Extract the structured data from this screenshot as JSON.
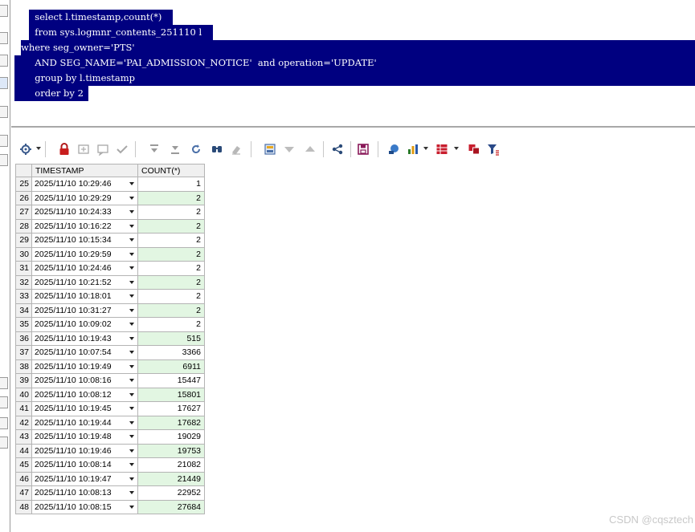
{
  "editor": {
    "sql_lines": [
      "  select l.timestamp,count(*)",
      "  from sys.logmnr_contents_251110 l",
      "where seg_owner='PTS'",
      "  AND SEG_NAME='PAI_ADMISSION_NOTICE'  and operation='UPDATE'",
      "  group by l.timestamp",
      "  order by 2"
    ],
    "selection_color": "#000080"
  },
  "toolbar": {
    "icons": [
      "settings-icon",
      "lock-icon",
      "add-record-icon",
      "comment-icon",
      "post-icon",
      "first-record-icon",
      "last-record-icon",
      "refresh-icon",
      "find-icon",
      "clear-icon",
      "query-by-example-icon",
      "sort-desc-icon",
      "sort-asc-icon",
      "link-icon",
      "save-icon",
      "export-icon",
      "chart-icon",
      "single-record-icon",
      "compare-icon",
      "filter-icon"
    ]
  },
  "grid": {
    "columns": [
      "TIMESTAMP",
      "COUNT(*)"
    ],
    "rows": [
      {
        "n": "25",
        "ts": "2025/11/10 10:29:46",
        "c": "1"
      },
      {
        "n": "26",
        "ts": "2025/11/10 10:29:29",
        "c": "2"
      },
      {
        "n": "27",
        "ts": "2025/11/10 10:24:33",
        "c": "2"
      },
      {
        "n": "28",
        "ts": "2025/11/10 10:16:22",
        "c": "2"
      },
      {
        "n": "29",
        "ts": "2025/11/10 10:15:34",
        "c": "2"
      },
      {
        "n": "30",
        "ts": "2025/11/10 10:29:59",
        "c": "2"
      },
      {
        "n": "31",
        "ts": "2025/11/10 10:24:46",
        "c": "2"
      },
      {
        "n": "32",
        "ts": "2025/11/10 10:21:52",
        "c": "2"
      },
      {
        "n": "33",
        "ts": "2025/11/10 10:18:01",
        "c": "2"
      },
      {
        "n": "34",
        "ts": "2025/11/10 10:31:27",
        "c": "2"
      },
      {
        "n": "35",
        "ts": "2025/11/10 10:09:02",
        "c": "2"
      },
      {
        "n": "36",
        "ts": "2025/11/10 10:19:43",
        "c": "515"
      },
      {
        "n": "37",
        "ts": "2025/11/10 10:07:54",
        "c": "3366"
      },
      {
        "n": "38",
        "ts": "2025/11/10 10:19:49",
        "c": "6911"
      },
      {
        "n": "39",
        "ts": "2025/11/10 10:08:16",
        "c": "15447"
      },
      {
        "n": "40",
        "ts": "2025/11/10 10:08:12",
        "c": "15801"
      },
      {
        "n": "41",
        "ts": "2025/11/10 10:19:45",
        "c": "17627"
      },
      {
        "n": "42",
        "ts": "2025/11/10 10:19:44",
        "c": "17682"
      },
      {
        "n": "43",
        "ts": "2025/11/10 10:19:48",
        "c": "19029"
      },
      {
        "n": "44",
        "ts": "2025/11/10 10:19:46",
        "c": "19753"
      },
      {
        "n": "45",
        "ts": "2025/11/10 10:08:14",
        "c": "21082"
      },
      {
        "n": "46",
        "ts": "2025/11/10 10:19:47",
        "c": "21449"
      },
      {
        "n": "47",
        "ts": "2025/11/10 10:08:13",
        "c": "22952"
      },
      {
        "n": "48",
        "ts": "2025/11/10 10:08:15",
        "c": "27684"
      }
    ]
  },
  "watermark": "CSDN @cqsztech"
}
